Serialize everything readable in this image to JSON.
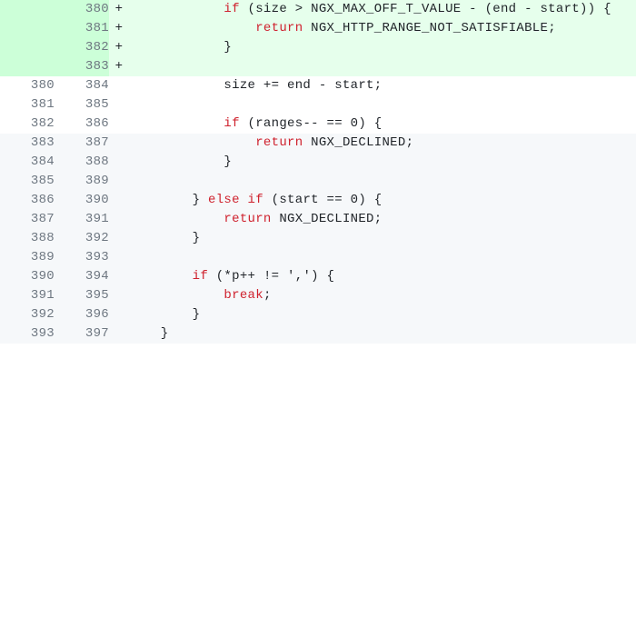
{
  "diff_lines": [
    {
      "old": "",
      "new": "380",
      "type": "addition",
      "marker": "+",
      "tokens": [
        [
          "plain",
          "            "
        ],
        [
          "kw",
          "if"
        ],
        [
          "plain",
          " (size > NGX_MAX_OFF_T_VALUE - (end - start)) {"
        ]
      ]
    },
    {
      "old": "",
      "new": "381",
      "type": "addition",
      "marker": "+",
      "tokens": [
        [
          "plain",
          "                "
        ],
        [
          "kw",
          "return"
        ],
        [
          "plain",
          " NGX_HTTP_RANGE_NOT_SATISFIABLE;"
        ]
      ]
    },
    {
      "old": "",
      "new": "382",
      "type": "addition",
      "marker": "+",
      "tokens": [
        [
          "plain",
          "            }"
        ]
      ]
    },
    {
      "old": "",
      "new": "383",
      "type": "addition",
      "marker": "+",
      "tokens": [
        [
          "plain",
          ""
        ]
      ]
    },
    {
      "old": "380",
      "new": "384",
      "type": "context",
      "marker": "",
      "tokens": [
        [
          "plain",
          "            size += end - start;"
        ]
      ]
    },
    {
      "old": "381",
      "new": "385",
      "type": "context",
      "marker": "",
      "tokens": [
        [
          "plain",
          ""
        ]
      ]
    },
    {
      "old": "382",
      "new": "386",
      "type": "context",
      "marker": "",
      "tokens": [
        [
          "plain",
          "            "
        ],
        [
          "kw",
          "if"
        ],
        [
          "plain",
          " (ranges-- == 0) {"
        ]
      ]
    },
    {
      "old": "383",
      "new": "387",
      "type": "context-alt",
      "marker": "",
      "tokens": [
        [
          "plain",
          "                "
        ],
        [
          "kw",
          "return"
        ],
        [
          "plain",
          " NGX_DECLINED;"
        ]
      ]
    },
    {
      "old": "384",
      "new": "388",
      "type": "context-alt",
      "marker": "",
      "tokens": [
        [
          "plain",
          "            }"
        ]
      ]
    },
    {
      "old": "385",
      "new": "389",
      "type": "context-alt",
      "marker": "",
      "tokens": [
        [
          "plain",
          ""
        ]
      ]
    },
    {
      "old": "386",
      "new": "390",
      "type": "context-alt",
      "marker": "",
      "tokens": [
        [
          "plain",
          "        } "
        ],
        [
          "kw",
          "else if"
        ],
        [
          "plain",
          " (start == 0) {"
        ]
      ]
    },
    {
      "old": "387",
      "new": "391",
      "type": "context-alt",
      "marker": "",
      "tokens": [
        [
          "plain",
          "            "
        ],
        [
          "kw",
          "return"
        ],
        [
          "plain",
          " NGX_DECLINED;"
        ]
      ]
    },
    {
      "old": "388",
      "new": "392",
      "type": "context-alt",
      "marker": "",
      "tokens": [
        [
          "plain",
          "        }"
        ]
      ]
    },
    {
      "old": "389",
      "new": "393",
      "type": "context-alt",
      "marker": "",
      "tokens": [
        [
          "plain",
          ""
        ]
      ]
    },
    {
      "old": "390",
      "new": "394",
      "type": "context-alt",
      "marker": "",
      "tokens": [
        [
          "plain",
          "        "
        ],
        [
          "kw",
          "if"
        ],
        [
          "plain",
          " (*p++ != ',') {"
        ]
      ]
    },
    {
      "old": "391",
      "new": "395",
      "type": "context-alt",
      "marker": "",
      "tokens": [
        [
          "plain",
          "            "
        ],
        [
          "kw",
          "break"
        ],
        [
          "plain",
          ";"
        ]
      ]
    },
    {
      "old": "392",
      "new": "396",
      "type": "context-alt",
      "marker": "",
      "tokens": [
        [
          "plain",
          "        }"
        ]
      ]
    },
    {
      "old": "393",
      "new": "397",
      "type": "context-alt",
      "marker": "",
      "tokens": [
        [
          "plain",
          "    }"
        ]
      ]
    }
  ]
}
